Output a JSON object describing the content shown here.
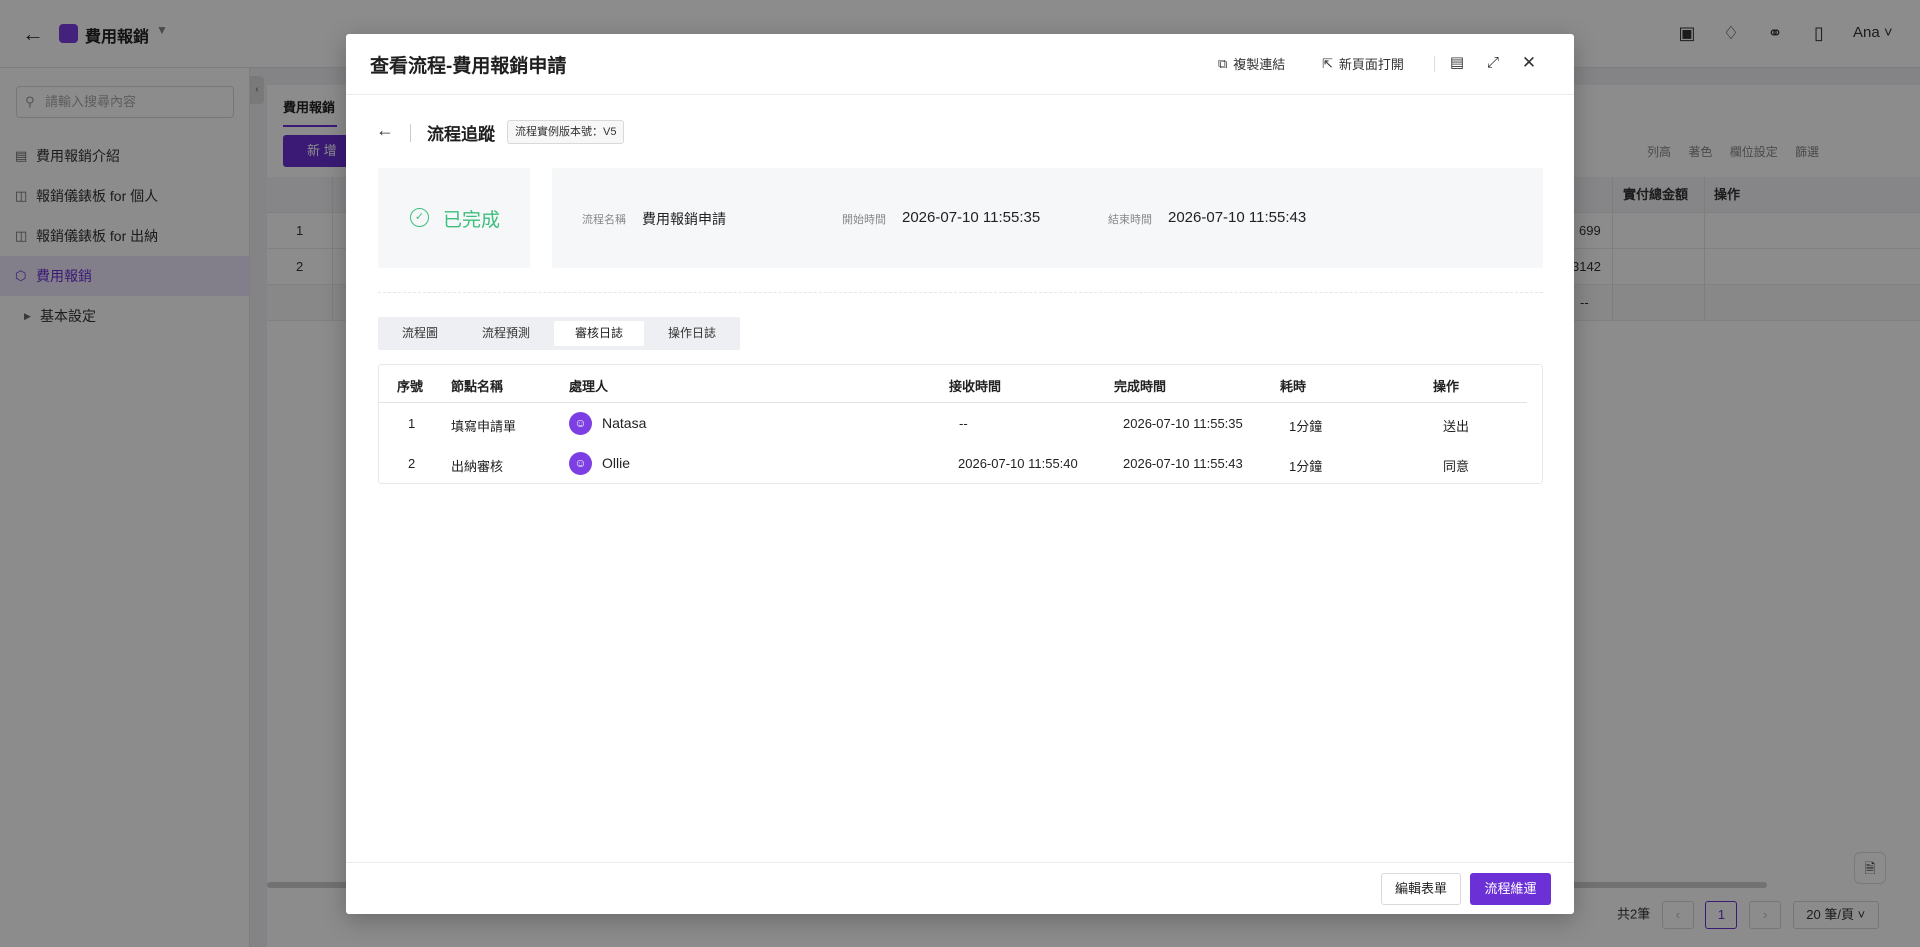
{
  "app": {
    "title": "費用報銷",
    "user": "Ana",
    "search_placeholder": "請輸入搜尋內容",
    "sidebar": [
      {
        "label": "費用報銷介紹",
        "icon": "table-icon"
      },
      {
        "label": "報銷儀錶板 for 個人",
        "icon": "dashboard-icon"
      },
      {
        "label": "報銷儀錶板 for 出納",
        "icon": "dashboard-icon"
      },
      {
        "label": "費用報銷",
        "icon": "box-icon",
        "active": true
      },
      {
        "label": "基本設定",
        "icon": "caret-right-icon"
      }
    ],
    "main": {
      "tab": "費用報銷",
      "new_button": "新 增",
      "tools": [
        "列高",
        "著色",
        "欄位設定",
        "篩選"
      ],
      "columns_visible": [
        "實付總金額",
        "操作"
      ],
      "rows": [
        {
          "index": "1",
          "amount": "699"
        },
        {
          "index": "2",
          "amount": "3142"
        }
      ],
      "summary_cell": "--",
      "pager": {
        "total": "共2筆",
        "page": "1",
        "size": "20 筆/頁"
      }
    }
  },
  "modal": {
    "title": "查看流程-費用報銷申請",
    "actions": {
      "copy_link": "複製連結",
      "open_new_page": "新頁面打開"
    },
    "trace": {
      "title": "流程追蹤",
      "version": "流程實例版本號：V5"
    },
    "status": "已完成",
    "info": {
      "name_label": "流程名稱",
      "name": "費用報銷申請",
      "start_label": "開始時間",
      "start": "2026-07-10 11:55:35",
      "end_label": "結束時間",
      "end": "2026-07-10 11:55:43"
    },
    "subtabs": [
      "流程圖",
      "流程預測",
      "審核日誌",
      "操作日誌"
    ],
    "active_subtab": "審核日誌",
    "table": {
      "headers": [
        "序號",
        "節點名稱",
        "處理人",
        "接收時間",
        "完成時間",
        "耗時",
        "操作"
      ],
      "rows": [
        {
          "no": "1",
          "node": "填寫申請單",
          "handler": "Natasa",
          "received": "--",
          "completed": "2026-07-10 11:55:35",
          "duration": "1分鐘",
          "action": "送出"
        },
        {
          "no": "2",
          "node": "出納審核",
          "handler": "Ollie",
          "received": "2026-07-10 11:55:40",
          "completed": "2026-07-10 11:55:43",
          "duration": "1分鐘",
          "action": "同意"
        }
      ]
    },
    "footer": {
      "edit_form": "編輯表單",
      "continue": "流程維運"
    },
    "colors": {
      "accent": "#6b30d6",
      "success": "#3cbf7c"
    }
  }
}
